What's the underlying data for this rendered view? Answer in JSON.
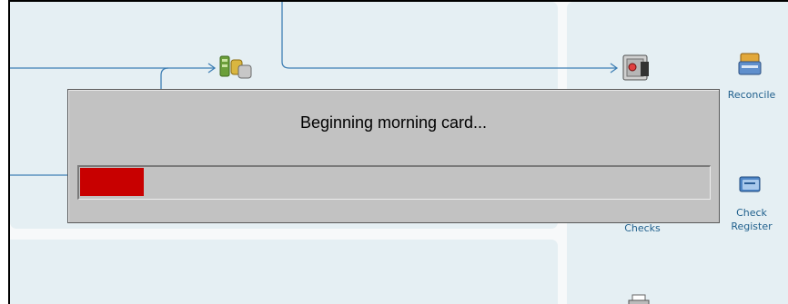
{
  "dialog": {
    "message": "Beginning morning card...",
    "progress_fraction": 0.101,
    "fill_color": "#c80000",
    "background_color": "#c2c2c2"
  },
  "side_panel": {
    "items": [
      {
        "label": "Reconcile",
        "icon": "reconcile-icon"
      },
      {
        "label_line1": "Check",
        "label_line2": "Register",
        "icon": "check-register-icon"
      },
      {
        "label": "Checks",
        "icon": "checks-icon"
      }
    ]
  },
  "flow": {
    "partial_label": "...",
    "icons": [
      "money-stack-icon",
      "safe-icon",
      "printer-icon"
    ]
  },
  "colors": {
    "panel_bg": "#e5eff3",
    "line": "#3e7fb4",
    "link_text": "#1f5f8c"
  }
}
